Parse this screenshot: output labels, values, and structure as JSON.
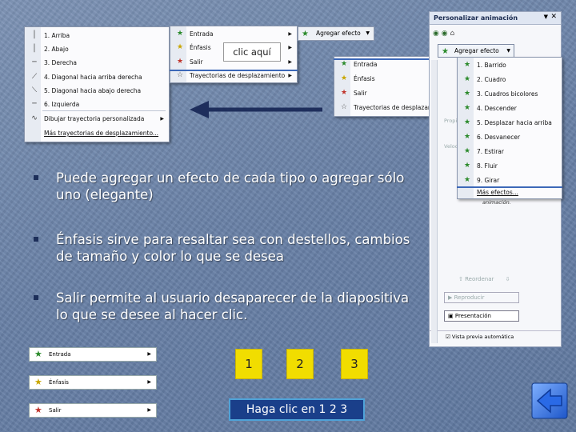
{
  "path_menu": {
    "items": [
      "1. Arriba",
      "2. Abajo",
      "3. Derecha",
      "4. Diagonal hacia arriba derecha",
      "5. Diagonal hacia abajo derecha",
      "6. Izquierda",
      "Dibujar trayectoria personalizada",
      "Más trayectorias de desplazamiento..."
    ],
    "icons": [
      "line-vertical-icon",
      "line-vertical-icon",
      "line-horizontal-icon",
      "line-diagonal-icon",
      "line-diagonal-icon",
      "line-horizontal-icon",
      "freeform-path-icon",
      ""
    ]
  },
  "effect_menu_top": {
    "items": [
      "Entrada",
      "Énfasis",
      "Salir",
      "Trayectorias de desplazamiento"
    ],
    "icons": [
      "entrance-star-icon",
      "emphasis-star-icon",
      "exit-star-icon",
      "path-star-icon"
    ],
    "overlay": "clic aquí"
  },
  "add_effect_button": "Agregar efecto",
  "effect_menu_mid": {
    "items": [
      "Entrada",
      "Énfasis",
      "Salir",
      "Trayectorias de desplazamiento"
    ],
    "icons": [
      "entrance-star-icon",
      "emphasis-star-icon",
      "exit-star-icon",
      "path-star-icon"
    ]
  },
  "entrance_submenu": {
    "items": [
      "1. Barrido",
      "2. Cuadro",
      "3. Cuadros bicolores",
      "4. Descender",
      "5. Desplazar hacia arriba",
      "6. Desvanecer",
      "7. Estirar",
      "8. Fluir",
      "9. Girar",
      "Más efectos..."
    ]
  },
  "task_pane": {
    "title": "Personalizar animación",
    "add_effect": "Agregar efecto",
    "property_label": "Propiedad:",
    "speed_label": "Velocidad:",
    "hint": "animación.",
    "reorder": "Reordenar",
    "play": "Reproducir",
    "slideshow": "Presentación",
    "auto_preview": "Vista previa automática"
  },
  "bullets": [
    "Puede agregar un efecto de cada tipo o agregar sólo uno (elegante)",
    "Énfasis sirve para resaltar sea con destellos, cambios de tamaño y color lo que se desea",
    "Salir permite al usuario desaparecer de la diapositiva lo que se desee al hacer clic."
  ],
  "mini_rows": [
    "Entrada",
    "Énfasis",
    "Salir"
  ],
  "numbers": [
    "1",
    "2",
    "3"
  ],
  "caption": "Haga clic en 1 2 3",
  "colors": {
    "accent_yellow": "#f1dd00",
    "caption_bg": "#1a3f8a",
    "nav_blue": "#2f6fd6"
  }
}
